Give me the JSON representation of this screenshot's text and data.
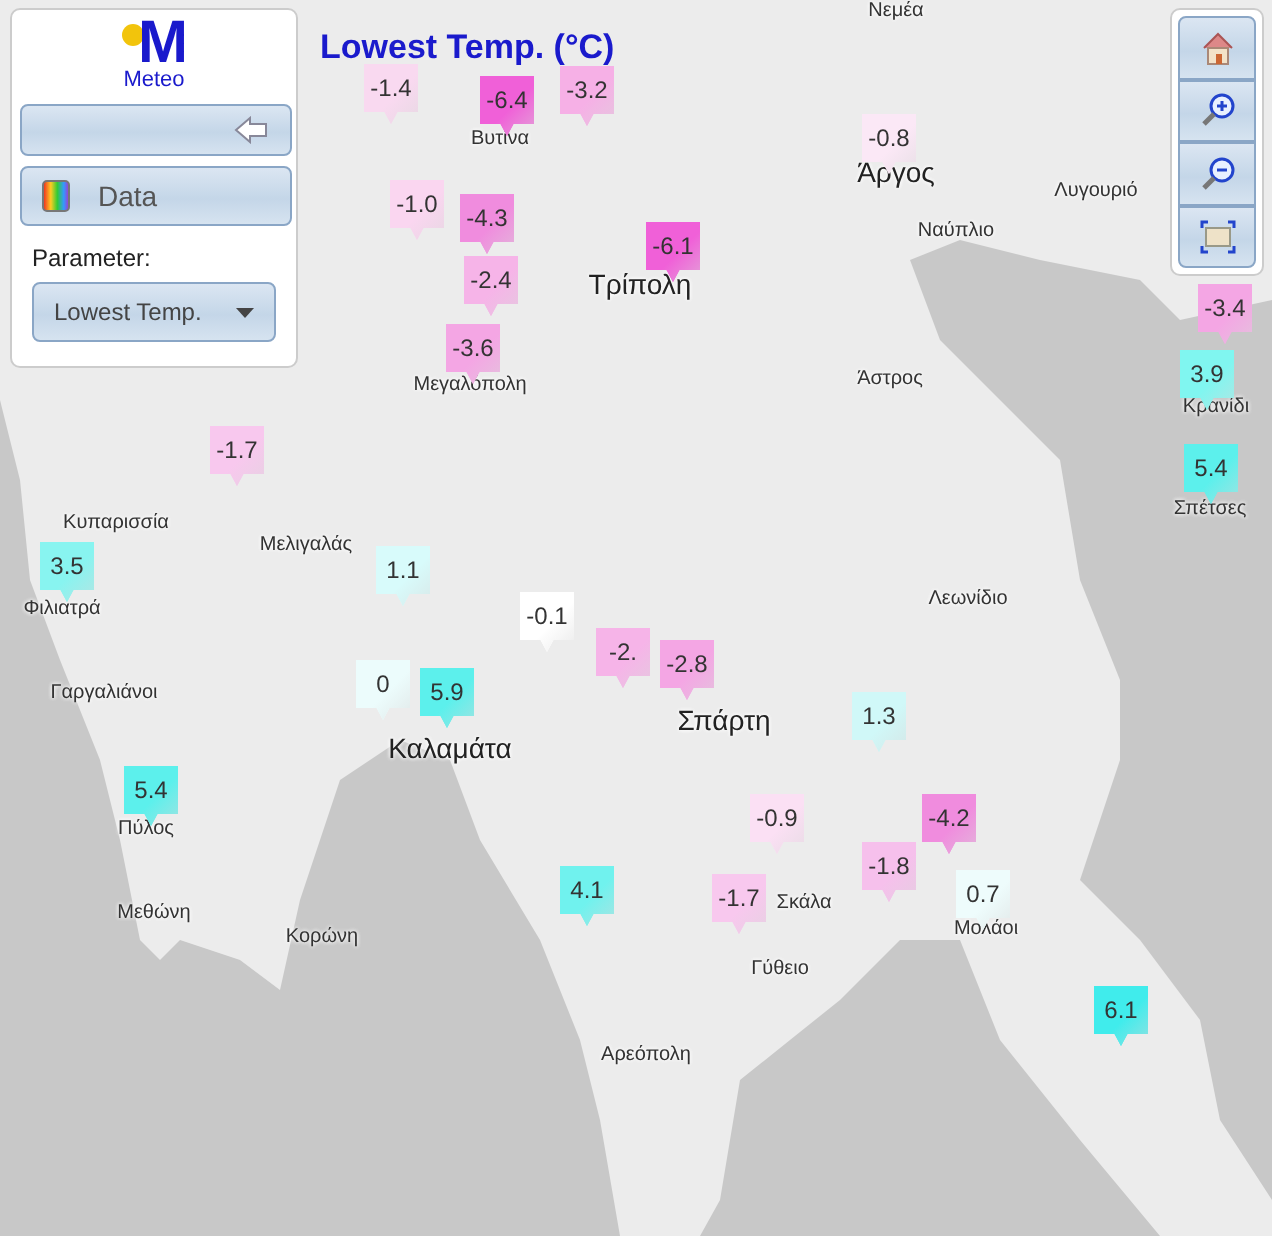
{
  "title": "Lowest Temp. (°C)",
  "panel": {
    "logo_mark": "M",
    "logo_text": "Meteo",
    "data_button": "Data",
    "parameter_label": "Parameter:",
    "parameter_value": "Lowest Temp."
  },
  "places": [
    {
      "name": "Νεμέα",
      "kind": "town"
    },
    {
      "name": "Βυτίνα",
      "kind": "town"
    },
    {
      "name": "Τρίπολη",
      "kind": "city"
    },
    {
      "name": "Άργος",
      "kind": "city"
    },
    {
      "name": "Ναύπλιο",
      "kind": "town"
    },
    {
      "name": "Λυγουριό",
      "kind": "town"
    },
    {
      "name": "Μεγαλόπολη",
      "kind": "town"
    },
    {
      "name": "Άστρος",
      "kind": "town"
    },
    {
      "name": "Κρανίδι",
      "kind": "town"
    },
    {
      "name": "Σπέτσες",
      "kind": "town"
    },
    {
      "name": "Κυπαρισσία",
      "kind": "town"
    },
    {
      "name": "Μελιγαλάς",
      "kind": "town"
    },
    {
      "name": "Φιλιατρά",
      "kind": "town"
    },
    {
      "name": "Λεωνίδιο",
      "kind": "town"
    },
    {
      "name": "Γαργαλιάνοι",
      "kind": "town"
    },
    {
      "name": "Καλαμάτα",
      "kind": "city"
    },
    {
      "name": "Σπάρτη",
      "kind": "city"
    },
    {
      "name": "Πύλος",
      "kind": "town"
    },
    {
      "name": "Σκάλα",
      "kind": "town"
    },
    {
      "name": "Μολάοι",
      "kind": "town"
    },
    {
      "name": "Μεθώνη",
      "kind": "town"
    },
    {
      "name": "Κορώνη",
      "kind": "town"
    },
    {
      "name": "Γύθειο",
      "kind": "town"
    },
    {
      "name": "Αρεόπολη",
      "kind": "town"
    }
  ],
  "markers": [
    {
      "value": "-1.4",
      "color": "#f9d9f0"
    },
    {
      "value": "-6.4",
      "color": "#f060d8"
    },
    {
      "value": "-3.2",
      "color": "#f6b0e6"
    },
    {
      "value": "-0.8",
      "color": "#fbe8f6"
    },
    {
      "value": "-1.0",
      "color": "#fad6f0"
    },
    {
      "value": "-4.3",
      "color": "#f08cde"
    },
    {
      "value": "-2.4",
      "color": "#f6b4e8"
    },
    {
      "value": "-6.1",
      "color": "#f060d8"
    },
    {
      "value": "-3.6",
      "color": "#f4a6e4"
    },
    {
      "value": "-3.4",
      "color": "#f4a6e4"
    },
    {
      "value": "3.9",
      "color": "#80f6f0"
    },
    {
      "value": "5.4",
      "color": "#5cf0ec"
    },
    {
      "value": "-1.7",
      "color": "#f8c8ee"
    },
    {
      "value": "3.5",
      "color": "#88f4f0"
    },
    {
      "value": "1.1",
      "color": "#d8fbfb"
    },
    {
      "value": "-0.1",
      "color": "#ffffff"
    },
    {
      "value": "0",
      "color": "#ecfcfc"
    },
    {
      "value": "5.9",
      "color": "#5cf0ec"
    },
    {
      "value": "-2.",
      "color": "#f6b4e8"
    },
    {
      "value": "-2.8",
      "color": "#f4a6e4"
    },
    {
      "value": "1.3",
      "color": "#d0f8f8"
    },
    {
      "value": "5.4",
      "color": "#5cf0ec"
    },
    {
      "value": "-0.9",
      "color": "#fbe0f4"
    },
    {
      "value": "-4.2",
      "color": "#f08cde"
    },
    {
      "value": "4.1",
      "color": "#70f2ee"
    },
    {
      "value": "-1.7",
      "color": "#f8c8ee"
    },
    {
      "value": "-1.8",
      "color": "#f6c0ec"
    },
    {
      "value": "0.7",
      "color": "#eefcfc"
    },
    {
      "value": "6.1",
      "color": "#40ecec"
    }
  ]
}
